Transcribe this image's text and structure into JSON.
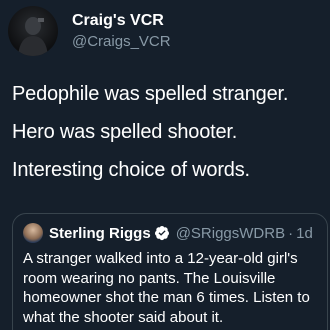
{
  "tweet": {
    "author": {
      "display_name": "Craig's VCR",
      "handle": "@Craigs_VCR"
    },
    "lines": [
      "Pedophile was spelled stranger.",
      "Hero was spelled shooter.",
      "Interesting choice of words."
    ]
  },
  "quoted_tweet": {
    "author": {
      "display_name": "Sterling Riggs",
      "handle": "@SRiggsWDRB",
      "verified_icon": "verified-badge-icon"
    },
    "separator": "·",
    "time": "1d",
    "text": "A stranger walked into a 12-year-old girl's room wearing no pants. The Louisville homeowner shot the man 6 times. Listen to what the shooter said about it."
  },
  "colors": {
    "background": "#151f2b",
    "secondary_text": "#8899a6",
    "border": "#38444d",
    "verified": "#1da1f2"
  }
}
